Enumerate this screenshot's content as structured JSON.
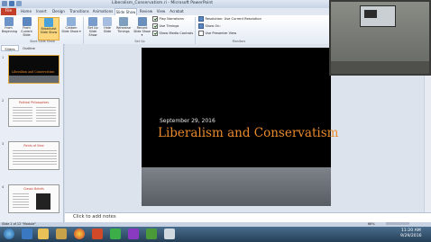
{
  "window": {
    "title": "Liberalism_Conservatism.ri - Microsoft PowerPoint"
  },
  "tabs": [
    "File",
    "Home",
    "Insert",
    "Design",
    "Transitions",
    "Animations",
    "Slide Show",
    "Review",
    "View",
    "Acrobat"
  ],
  "active_tab": "Slide Show",
  "ribbon": {
    "start": {
      "label": "Start Slide Show",
      "from_beginning": "From Beginning",
      "from_current": "From Current Slide",
      "broadcast": "Broadcast Slide Show",
      "custom": "Custom Slide Show ▾"
    },
    "setup": {
      "label": "Set Up",
      "setup_show": "Set Up Slide Show",
      "hide_slide": "Hide Slide",
      "rehearse": "Rehearse Timings",
      "record": "Record Slide Show ▾",
      "play_narrations": "Play Narrations",
      "use_timings": "Use Timings",
      "show_media_controls": "Show Media Controls"
    },
    "monitors": {
      "label": "Monitors",
      "resolution": "Resolution: Use Current Resolution",
      "show_on": "Show On:",
      "presenter_view": "Use Presenter View"
    }
  },
  "left_pane": {
    "tabs": [
      "Slides",
      "Outline"
    ],
    "thumbnails": [
      {
        "num": "1",
        "title": "Liberalism and Conservatism",
        "bg": "#0a0a0a",
        "title_color": "#e8892b"
      },
      {
        "num": "2",
        "title": "Political Philosophies",
        "bg": "#fafafa",
        "title_color": "#c0392b"
      },
      {
        "num": "3",
        "title": "Points of View",
        "bg": "#fafafa",
        "title_color": "#c0392b"
      },
      {
        "num": "4",
        "title": "Classic Beliefs",
        "bg": "#fafafa",
        "title_color": "#c0392b"
      }
    ]
  },
  "slide": {
    "date": "September 29, 2016",
    "title": "Liberalism and Conservatism"
  },
  "notes_placeholder": "Click to add notes",
  "status": {
    "slide_info": "Slide 1 of 12   \"Module\"",
    "zoom": "66%"
  },
  "clock": {
    "time": "11:20 AM",
    "date": "9/29/2016"
  },
  "colors": {
    "file_tab": "#c43f2a",
    "slide_title": "#e8892b",
    "ribbon_selected": "#fbd67c"
  }
}
